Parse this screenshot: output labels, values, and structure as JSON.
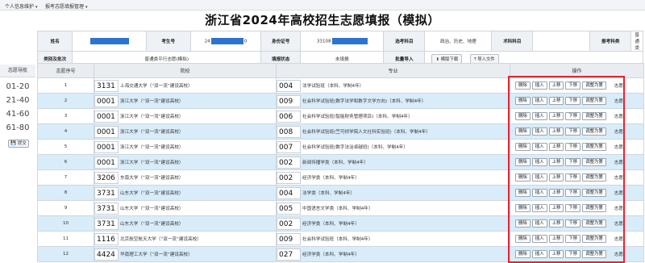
{
  "topmenu": {
    "item1": "个人信息维护",
    "item2": "报考志愿填报管理"
  },
  "title": "浙江省2024年高校招生志愿填报（模拟）",
  "info": {
    "name_label": "姓名",
    "exam_no_label": "考生号",
    "exam_no_prefix": "24",
    "exam_no_suffix": "0",
    "id_label": "身份证号",
    "id_prefix": "33108",
    "subjects_label": "选考科目",
    "subjects_value": "政治、历史、地理",
    "art_label": "术科科目",
    "category_label": "报考科类",
    "category_value": "普通类",
    "batch_label": "类别及批次",
    "batch_value": "普通类平行志愿(模拟)",
    "status_label": "填报状态",
    "status_value": "未填报",
    "import_label": "批量导入",
    "template_button": "模版下载",
    "import_button": "导入文件"
  },
  "side": {
    "header": "志愿导航",
    "ranges": [
      "01-20",
      "21-40",
      "41-60",
      "61-80"
    ],
    "submit": "提交"
  },
  "table": {
    "headers": {
      "no": "志愿序号",
      "school": "院校",
      "major": "专业",
      "ops": "操作"
    },
    "op_buttons": [
      "删除",
      "插入",
      "上移",
      "下移",
      "调整为第"
    ],
    "op_suffix": "志愿",
    "rows": [
      {
        "no": "1",
        "school_code": "3131",
        "school_name": "上海交通大学（“双一流”建设高校）",
        "major_code": "004",
        "major_name": "法学试验班（本科、学制4年）"
      },
      {
        "no": "2",
        "school_code": "0001",
        "school_name": "浙江大学（“双一流”建设高校）",
        "major_code": "009",
        "major_name": "社会科学试验班(数字法学和数字文学方向)（本科、学制4年）"
      },
      {
        "no": "3",
        "school_code": "0001",
        "school_name": "浙江大学（“双一流”建设高校）",
        "major_code": "006",
        "major_name": "社会科学试验班(智能财务管理项目)（本科、学制4年）"
      },
      {
        "no": "4",
        "school_code": "0001",
        "school_name": "浙江大学（“双一流”建设高校）",
        "major_code": "008",
        "major_name": "社会科学试验班(竺可桢学院人文社科实验班)（本科、学制4年）"
      },
      {
        "no": "5",
        "school_code": "0001",
        "school_name": "浙江大学（“双一流”建设高校）",
        "major_code": "007",
        "major_name": "社会科学试验班(数字法治卓越班)（本科、学制4年）"
      },
      {
        "no": "6",
        "school_code": "0001",
        "school_name": "浙江大学（“双一流”建设高校）",
        "major_code": "002",
        "major_name": "新闻传播学类（本科、学制4年）"
      },
      {
        "no": "7",
        "school_code": "3206",
        "school_name": "东南大学（“双一流”建设高校）",
        "major_code": "002",
        "major_name": "经济学类（本科、学制4年）"
      },
      {
        "no": "8",
        "school_code": "3731",
        "school_name": "山东大学（“双一流”建设高校）",
        "major_code": "004",
        "major_name": "法学类（本科、学制4年）"
      },
      {
        "no": "9",
        "school_code": "3731",
        "school_name": "山东大学（“双一流”建设高校）",
        "major_code": "005",
        "major_name": "中国语言文学类（本科、学制4年）"
      },
      {
        "no": "10",
        "school_code": "3731",
        "school_name": "山东大学（“双一流”建设高校）",
        "major_code": "002",
        "major_name": "经济学类（本科、学制4年）"
      },
      {
        "no": "11",
        "school_code": "1116",
        "school_name": "北京航空航天大学（“双一流”建设高校）",
        "major_code": "009",
        "major_name": "社会科学试验班（本科、学制4年）"
      },
      {
        "no": "12",
        "school_code": "4424",
        "school_name": "华南理工大学（“双一流”建设高校）",
        "major_code": "027",
        "major_name": "经济学类（本科、学制4年）"
      }
    ]
  },
  "colors": {
    "highlight_border": "#e8232f",
    "alt_row": "#d9ecfa",
    "mask": "#2f73d1"
  }
}
